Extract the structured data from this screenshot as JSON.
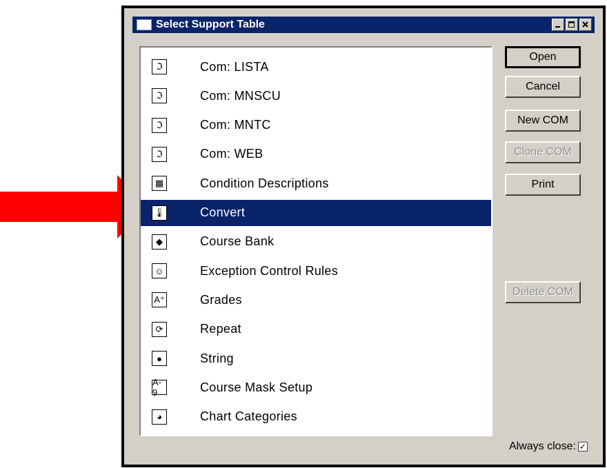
{
  "window": {
    "title": "Select Support Table",
    "min_symbol": "_",
    "max_symbol": "□",
    "close_symbol": "✕"
  },
  "list": {
    "items": [
      {
        "label": "Com:  LISTA",
        "icon": "com-document-icon",
        "glyph": "ℑ",
        "selected": false
      },
      {
        "label": "Com:  MNSCU",
        "icon": "com-document-icon",
        "glyph": "ℑ",
        "selected": false
      },
      {
        "label": "Com:  MNTC",
        "icon": "com-document-icon",
        "glyph": "ℑ",
        "selected": false
      },
      {
        "label": "Com:  WEB",
        "icon": "com-document-icon",
        "glyph": "ℑ",
        "selected": false
      },
      {
        "label": "Condition Descriptions",
        "icon": "condition-grid-icon",
        "glyph": "▦",
        "selected": false
      },
      {
        "label": "Convert",
        "icon": "thermometer-convert-icon",
        "glyph": "🌡",
        "selected": true
      },
      {
        "label": "Course Bank",
        "icon": "books-icon",
        "glyph": "◆",
        "selected": false
      },
      {
        "label": "Exception Control Rules",
        "icon": "smiley-icon",
        "glyph": "☺",
        "selected": false
      },
      {
        "label": "Grades",
        "icon": "grade-a-plus-icon",
        "glyph": "A⁺",
        "selected": false
      },
      {
        "label": "Repeat",
        "icon": "repeat-arrows-icon",
        "glyph": "⟳",
        "selected": false
      },
      {
        "label": "String",
        "icon": "yarn-ball-icon",
        "glyph": "●",
        "selected": false
      },
      {
        "label": "Course Mask Setup",
        "icon": "mask-a9-icon",
        "glyph": "A-9",
        "selected": false
      },
      {
        "label": "Chart Categories",
        "icon": "pie-chart-icon",
        "glyph": "◕",
        "selected": false
      }
    ]
  },
  "buttons": {
    "open": "Open",
    "cancel": "Cancel",
    "new_com": "New COM",
    "clone_com": "Clone COM",
    "print": "Print",
    "delete_com": "Delete COM"
  },
  "always_close": {
    "label": "Always close:",
    "checked": true,
    "mark": "✓"
  },
  "colors": {
    "title_bar": "#0a246a",
    "selection": "#0a246a",
    "dialog_bg": "#d4d0c8",
    "arrow": "#ff0000"
  }
}
